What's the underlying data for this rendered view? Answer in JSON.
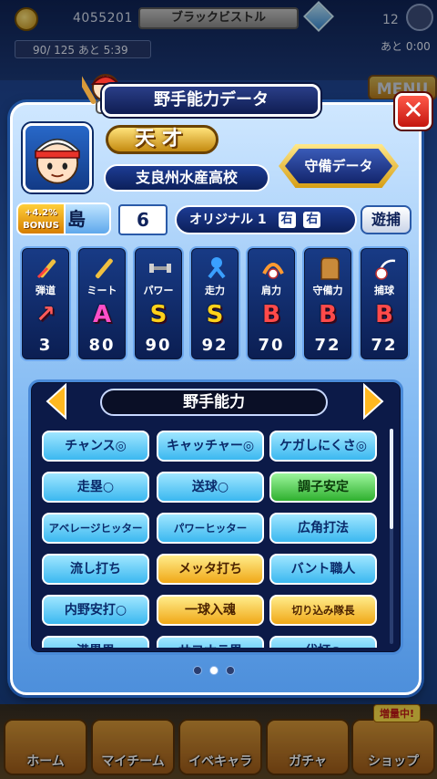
{
  "hud": {
    "coins": "4055201",
    "team_name": "ブラックビストル",
    "gems": "12",
    "stamina": "90/ 125 あと 5:39",
    "timer": "あと 0:00",
    "menu_label": "MENU"
  },
  "dialog": {
    "title": "野手能力データ",
    "close_label": "✕",
    "rank": "天才",
    "school": "支良州水産高校",
    "defense_button": "守備データ",
    "bonus_percent": "+4.2%",
    "bonus_label": "BONUS",
    "island": "島",
    "jersey_number": "6",
    "original_name": "オリジナル 1",
    "throws": "右",
    "bats": "右",
    "position": "遊捕"
  },
  "stats": [
    {
      "name": "弾道",
      "grade": "↗",
      "value": "3",
      "color": "#ff5a5a"
    },
    {
      "name": "ミート",
      "grade": "A",
      "value": "80",
      "color": "#ff4fc8"
    },
    {
      "name": "パワー",
      "grade": "S",
      "value": "90",
      "color": "#ffd21a"
    },
    {
      "name": "走力",
      "grade": "S",
      "value": "92",
      "color": "#ffd21a"
    },
    {
      "name": "肩力",
      "grade": "B",
      "value": "70",
      "color": "#ff4a4a"
    },
    {
      "name": "守備力",
      "grade": "B",
      "value": "72",
      "color": "#ff4a4a"
    },
    {
      "name": "捕球",
      "grade": "B",
      "value": "72",
      "color": "#ff4a4a"
    }
  ],
  "abilities_panel": {
    "title": "野手能力",
    "items": [
      {
        "label": "チャンス◎",
        "style": "blue"
      },
      {
        "label": "キャッチャー◎",
        "style": "blue"
      },
      {
        "label": "ケガしにくさ◎",
        "style": "blue"
      },
      {
        "label": "走塁○",
        "style": "blue"
      },
      {
        "label": "送球○",
        "style": "blue"
      },
      {
        "label": "調子安定",
        "style": "green"
      },
      {
        "label": "アベレージヒッター",
        "style": "blue"
      },
      {
        "label": "パワーヒッター",
        "style": "blue"
      },
      {
        "label": "広角打法",
        "style": "blue"
      },
      {
        "label": "流し打ち",
        "style": "blue"
      },
      {
        "label": "メッタ打ち",
        "style": "gold"
      },
      {
        "label": "バント職人",
        "style": "blue"
      },
      {
        "label": "内野安打○",
        "style": "blue"
      },
      {
        "label": "一球入魂",
        "style": "gold"
      },
      {
        "label": "切り込み隊長",
        "style": "gold"
      },
      {
        "label": "満塁男",
        "style": "blue"
      },
      {
        "label": "サヨナラ男",
        "style": "blue"
      },
      {
        "label": "代打○",
        "style": "blue"
      }
    ]
  },
  "bottom_nav": {
    "items": [
      "ホーム",
      "マイチーム",
      "イベキャラ",
      "ガチャ",
      "ショップ"
    ],
    "badge": "増量中!"
  }
}
